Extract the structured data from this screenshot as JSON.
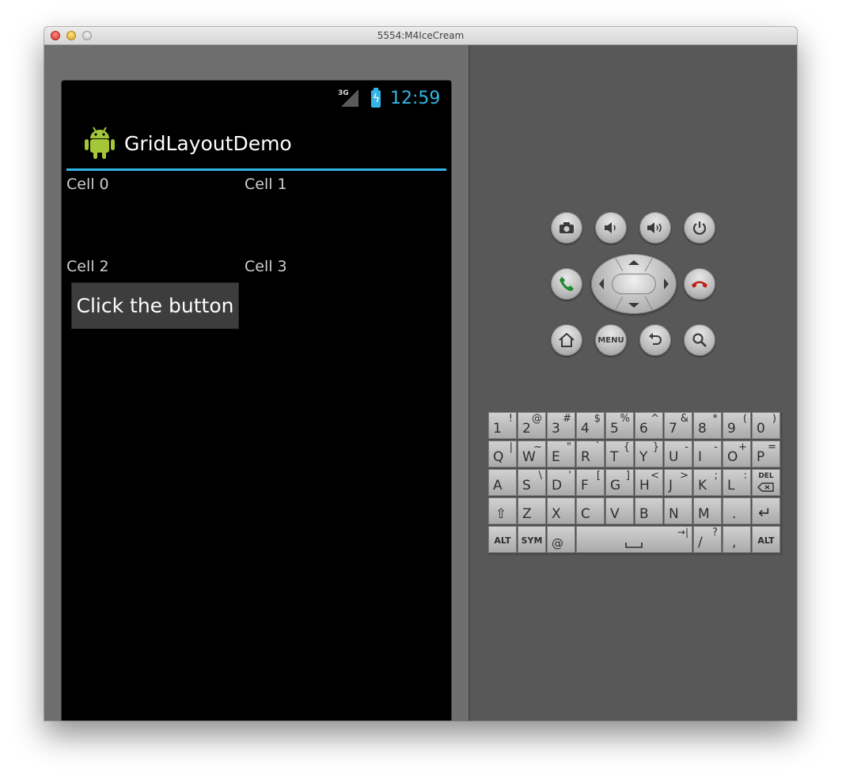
{
  "window": {
    "title": "5554:M4IceCream"
  },
  "status_bar": {
    "network": "3G",
    "time": "12:59"
  },
  "action_bar": {
    "app_title": "GridLayoutDemo"
  },
  "grid": {
    "cells": [
      "Cell 0",
      "Cell 1",
      "Cell 2",
      "Cell 3"
    ],
    "button_label": "Click the button"
  },
  "controls": {
    "menu_label": "MENU"
  },
  "keyboard": {
    "rows": [
      [
        [
          "1",
          "!"
        ],
        [
          "2",
          "@"
        ],
        [
          "3",
          "#"
        ],
        [
          "4",
          "$"
        ],
        [
          "5",
          "%"
        ],
        [
          "6",
          "^"
        ],
        [
          "7",
          "&"
        ],
        [
          "8",
          "*"
        ],
        [
          "9",
          "("
        ],
        [
          "0",
          ")"
        ]
      ],
      [
        [
          "Q",
          "|"
        ],
        [
          "W",
          "~"
        ],
        [
          "E",
          "\""
        ],
        [
          "R",
          "`"
        ],
        [
          "T",
          "{"
        ],
        [
          "Y",
          "}"
        ],
        [
          "U",
          "-"
        ],
        [
          "I",
          "-"
        ],
        [
          "O",
          "+"
        ],
        [
          "P",
          "="
        ]
      ],
      [
        [
          "A",
          ""
        ],
        [
          "S",
          "\\"
        ],
        [
          "D",
          "'"
        ],
        [
          "F",
          "["
        ],
        [
          "G",
          "]"
        ],
        [
          "H",
          "<"
        ],
        [
          "J",
          ">"
        ],
        [
          "K",
          ";"
        ],
        [
          "L",
          ":"
        ],
        [
          "DEL",
          ""
        ]
      ],
      [
        [
          "⇧",
          ""
        ],
        [
          "Z",
          ""
        ],
        [
          "X",
          ""
        ],
        [
          "C",
          ""
        ],
        [
          "V",
          ""
        ],
        [
          "B",
          ""
        ],
        [
          "N",
          ""
        ],
        [
          "M",
          ""
        ],
        [
          ".",
          ""
        ],
        [
          "↵",
          ""
        ]
      ]
    ],
    "bottom_row": {
      "alt_left": "ALT",
      "sym": "SYM",
      "at": "@",
      "tab": "→|",
      "slash": "/",
      "question": "?",
      "comma": ",",
      "alt_right": "ALT"
    }
  },
  "colors": {
    "accent": "#33b5e5",
    "screen_bg": "#000000",
    "emulator_bg": "#595859"
  }
}
